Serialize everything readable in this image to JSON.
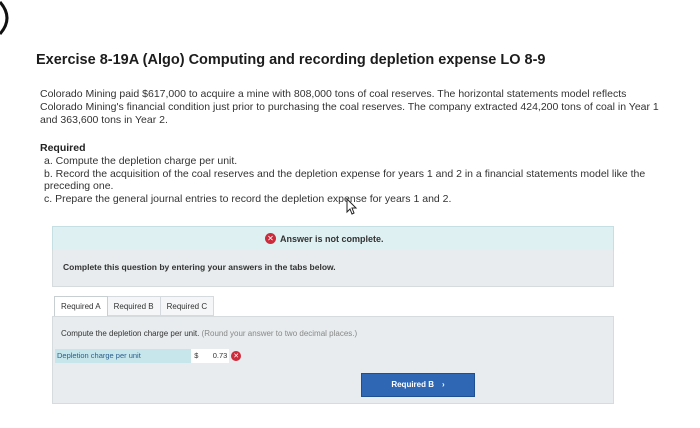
{
  "title": "Exercise 8-19A (Algo) Computing and recording depletion expense LO 8-9",
  "intro": "Colorado Mining paid $617,000 to acquire a mine with 808,000 tons of coal reserves. The horizontal statements model reflects Colorado Mining's financial condition just prior to purchasing the coal reserves. The company extracted 424,200 tons of coal in Year 1 and 363,600 tons in Year 2.",
  "required_heading": "Required",
  "requirements": [
    "a. Compute the depletion charge per unit.",
    "b. Record the acquisition of the coal reserves and the depletion expense for years 1 and 2 in a financial statements model like the preceding one.",
    "c. Prepare the general journal entries to record the depletion expense for years 1 and 2."
  ],
  "status": {
    "icon": "x-circle-icon",
    "text": "Answer is not complete.",
    "color": "#cc2b3b"
  },
  "instruction": "Complete this question by entering your answers in the tabs below.",
  "tabs": [
    {
      "label": "Required A",
      "active": true
    },
    {
      "label": "Required B",
      "active": false
    },
    {
      "label": "Required C",
      "active": false
    }
  ],
  "panel": {
    "prompt": "Compute the depletion charge per unit.",
    "hint": "(Round your answer to two decimal places.)",
    "field_label": "Depletion charge per unit",
    "currency": "$",
    "value": "0.73",
    "next_label": "Required B",
    "next_icon": "chevron-right-icon"
  }
}
